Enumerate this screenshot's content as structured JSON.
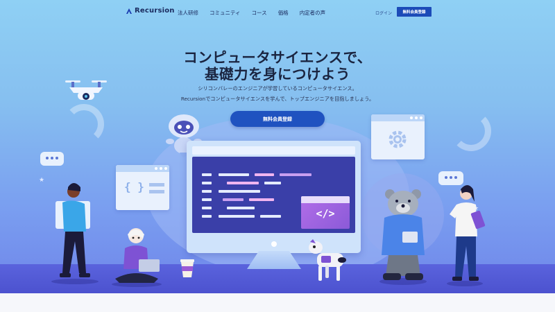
{
  "header": {
    "logo_text": "Recursion",
    "nav": [
      "法人研修",
      "コミュニティ",
      "コース",
      "価格",
      "内定者の声"
    ],
    "login_label": "ログイン",
    "signup_label": "無料会員登録"
  },
  "hero": {
    "headline_line1": "コンピュータサイエンスで、",
    "headline_line2": "基礎力を身につけよう",
    "sub_line1": "シリコンバレーのエンジニアが学習しているコンピュータサイエンス。",
    "sub_line2": "Recursionでコンピュータサイエンスを学んで、トップエンジニアを目指しましょう。",
    "cta_label": "無料会員登録",
    "code_symbol": "</>",
    "brace_symbol": "{ }"
  },
  "colors": {
    "brand_navy": "#1a2a5e",
    "cta_blue": "#1f52c0",
    "sky_top": "#8fd0f4",
    "sky_bottom": "#6f85ea",
    "floor": "#4c52cf"
  },
  "icons": [
    "recursion-logo-icon",
    "drone-icon",
    "robot-icon",
    "gear-icon",
    "chat-bubble-icon",
    "code-icon",
    "braces-icon",
    "coffee-cup-icon",
    "robot-dog-icon",
    "bear-mascot-icon",
    "star-icon"
  ]
}
